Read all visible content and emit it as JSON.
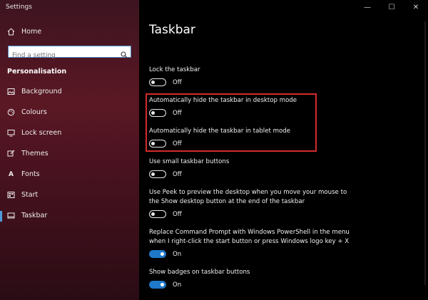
{
  "window": {
    "title": "Settings",
    "controls": {
      "minimize": "—",
      "maximize": "☐",
      "close": "✕"
    }
  },
  "sidebar": {
    "home": "Home",
    "search_placeholder": "Find a setting",
    "section": "Personalisation",
    "items": [
      {
        "label": "Background",
        "icon": "image-icon"
      },
      {
        "label": "Colours",
        "icon": "palette-icon"
      },
      {
        "label": "Lock screen",
        "icon": "monitor-icon"
      },
      {
        "label": "Themes",
        "icon": "brush-icon"
      },
      {
        "label": "Fonts",
        "icon": "font-icon"
      },
      {
        "label": "Start",
        "icon": "start-icon"
      },
      {
        "label": "Taskbar",
        "icon": "taskbar-icon",
        "active": true
      }
    ]
  },
  "main": {
    "title": "Taskbar",
    "settings": [
      {
        "label": "Lock the taskbar",
        "state": "Off"
      },
      {
        "label": "Automatically hide the taskbar in desktop mode",
        "state": "Off"
      },
      {
        "label": "Automatically hide the taskbar in tablet mode",
        "state": "Off"
      },
      {
        "label": "Use small taskbar buttons",
        "state": "Off"
      },
      {
        "label_lines": [
          "Use Peek to preview the desktop when you move your mouse to",
          "the Show desktop button at the end of the taskbar"
        ],
        "state": "Off"
      },
      {
        "label_lines": [
          "Replace Command Prompt with Windows PowerShell in the menu",
          "when I right-click the start button or press Windows logo key + X"
        ],
        "state": "On"
      },
      {
        "label": "Show badges on taskbar buttons",
        "state": "On"
      }
    ]
  },
  "colors": {
    "accent": "#1f78c8",
    "highlight": "#d42b2b"
  }
}
